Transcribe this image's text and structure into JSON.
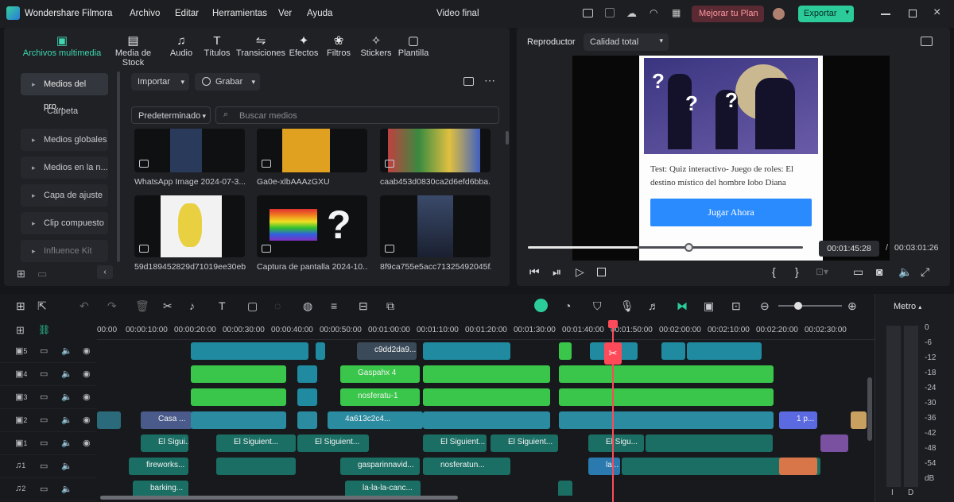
{
  "app": {
    "name": "Wondershare Filmora",
    "project_title": "Video final"
  },
  "menu": [
    "Archivo",
    "Editar",
    "Herramientas",
    "Ver",
    "Ayuda"
  ],
  "header": {
    "upgrade_label": "Mejorar tu Plan",
    "export_label": "Exportar"
  },
  "media_tabs": [
    {
      "label": "Archivos multimedia",
      "icon": "media-files-icon",
      "active": true
    },
    {
      "label": "Media de Stock",
      "icon": "stock-media-icon"
    },
    {
      "label": "Audio",
      "icon": "music-note-icon"
    },
    {
      "label": "Títulos",
      "icon": "text-t-icon"
    },
    {
      "label": "Transiciones",
      "icon": "transition-icon"
    },
    {
      "label": "Efectos",
      "icon": "sparkle-icon"
    },
    {
      "label": "Filtros",
      "icon": "filter-icon"
    },
    {
      "label": "Stickers",
      "icon": "sticker-icon"
    },
    {
      "label": "Plantilla",
      "icon": "template-icon"
    }
  ],
  "sidebar": {
    "items": [
      {
        "label": "Medios del pro...",
        "expanded": true
      },
      {
        "label": "Carpeta"
      },
      {
        "label": "Medios globales"
      },
      {
        "label": "Medios en la n..."
      },
      {
        "label": "Capa de ajuste"
      },
      {
        "label": "Clip compuesto"
      },
      {
        "label": "Influence Kit"
      }
    ]
  },
  "media_toolbar": {
    "import_label": "Importar",
    "record_label": "Grabar",
    "sort_label": "Predeterminado",
    "search_placeholder": "Buscar medios"
  },
  "media_items": [
    {
      "name": "WhatsApp Image 2024-07-3..."
    },
    {
      "name": "Ga0e-xlbAAAzGXU"
    },
    {
      "name": "caab453d0830ca2d6efd6bba..."
    },
    {
      "name": "59d189452829d71019ee30eb..."
    },
    {
      "name": "Captura de pantalla 2024-10..."
    },
    {
      "name": "8f9ca755e5acc71325492045f..."
    }
  ],
  "player": {
    "tab_label": "Reproductor",
    "quality_label": "Calidad total",
    "preview_text": "Test: Quiz interactivo- Juego de roles: El destino místico del hombre lobo Diana",
    "preview_button": "Jugar Ahora",
    "current_time": "00:01:45:28",
    "separator": "/",
    "total_time": "00:03:01:26",
    "progress": 0.4,
    "colors": {
      "accent": "#2a8bff",
      "export": "#2bcc9a",
      "upgrade": "#5a2a33",
      "playhead": "#ff4a5a"
    }
  },
  "timeline": {
    "ticks": [
      "00:00",
      "00:00:10:00",
      "00:00:20:00",
      "00:00:30:00",
      "00:00:40:00",
      "00:00:50:00",
      "00:01:00:00",
      "00:01:10:00",
      "00:01:20:00",
      "00:01:30:00",
      "00:01:40:00",
      "00:01:50:00",
      "00:02:00:00",
      "00:02:10:00",
      "00:02:20:00",
      "00:02:30:00"
    ],
    "tracks": [
      {
        "num": "5",
        "type": "video"
      },
      {
        "num": "4",
        "type": "video"
      },
      {
        "num": "3",
        "type": "video"
      },
      {
        "num": "2",
        "type": "video"
      },
      {
        "num": "1",
        "type": "video"
      },
      {
        "num": "1",
        "type": "audio"
      },
      {
        "num": "2",
        "type": "audio"
      }
    ],
    "clip_labels": {
      "t5": "c9dd2da9...",
      "t4": "Gaspahx 4",
      "t3": "nosferatu-1",
      "t2a": "Casa ...",
      "t2b": "4a613c2c4...",
      "t2text": "1 p...",
      "t1a": "El Sigui...",
      "t1b": "El Siguient...",
      "t1c": "El Siguient...",
      "t1d": "El Siguient...",
      "t1e": "El Siguient...",
      "t1f": "El Sigu...",
      "a1a": "fireworks...",
      "a1b": "gasparinnavid...",
      "a1c": "nosferatun...",
      "a1d": "la...",
      "a2a": "barking...",
      "a2b": "la-la-la-canc..."
    }
  },
  "meter": {
    "label": "Metro",
    "scale": [
      "0",
      "-6",
      "-12",
      "-18",
      "-24",
      "-30",
      "-36",
      "-42",
      "-48",
      "-54",
      "dB"
    ],
    "channels": [
      "I",
      "D"
    ]
  }
}
